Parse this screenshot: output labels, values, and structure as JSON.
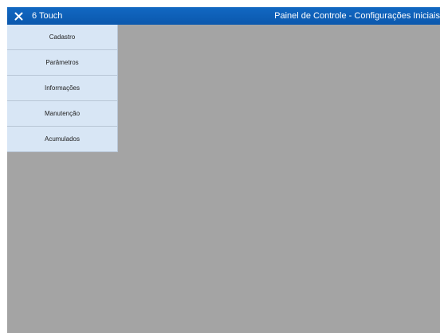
{
  "header": {
    "close_icon": "close-icon",
    "app_name": "6 Touch",
    "screen_title": "Painel de Controle - Configurações Iniciais"
  },
  "colors": {
    "header_bg": "#0b5fb5",
    "menu_bg": "#d8e6f5",
    "content_bg": "#a4a4a4"
  },
  "menu": {
    "items": [
      {
        "label": "Cadastro"
      },
      {
        "label": "Parâmetros"
      },
      {
        "label": "Informações"
      },
      {
        "label": "Manutenção"
      },
      {
        "label": "Acumulados"
      }
    ]
  }
}
